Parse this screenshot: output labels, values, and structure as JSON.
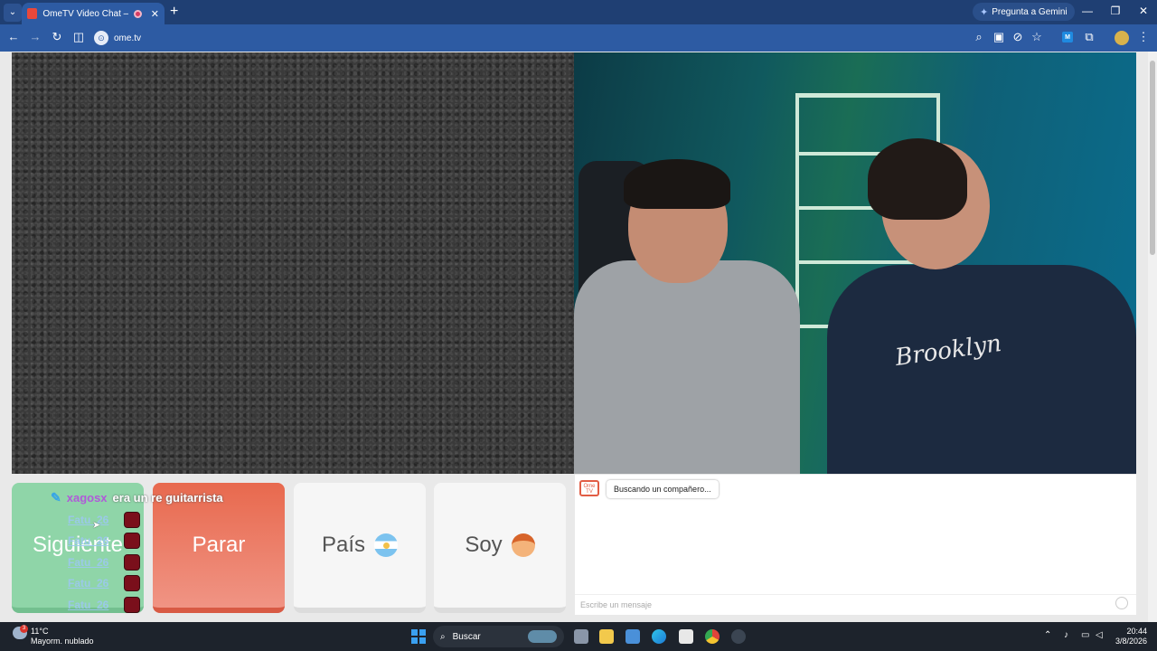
{
  "browser": {
    "tab_title": "OmeTV Video Chat — Ome",
    "gemini_label": "Pregunta a Gemini",
    "url": "ome.tv"
  },
  "overlay": {
    "username": "xagosx",
    "message": "era un re guitarrista",
    "feed": [
      "Fatu_26",
      "Fatu_26",
      "Fatu_26",
      "Fatu_26",
      "Fatu_26"
    ]
  },
  "buttons": {
    "next": "Siguiente",
    "stop": "Parar",
    "country": "País",
    "gender": "Soy"
  },
  "chat": {
    "logo": "Ome TV",
    "status": "Buscando un compañero...",
    "placeholder": "Escribe un mensaje"
  },
  "taskbar": {
    "temperature": "11°C",
    "weather": "Mayorm. nublado",
    "weather_badge": "3",
    "search": "Buscar",
    "time": "20:44",
    "date": "3/8/2026"
  }
}
